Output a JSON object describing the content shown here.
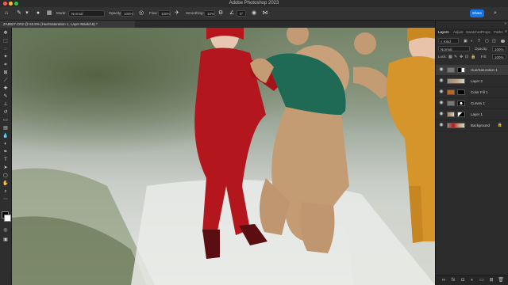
{
  "app": {
    "title": "Adobe Photoshop 2023"
  },
  "options_bar": {
    "mode_label": "Mode:",
    "mode_value": "Normal",
    "opacity_label": "Opacity:",
    "opacity_value": "100%",
    "flow_label": "Flow:",
    "flow_value": "100%",
    "smoothing_label": "Smoothing:",
    "smoothing_value": "10%",
    "angle_value": "0°",
    "share_label": "Share"
  },
  "document": {
    "tab_title": "ZA8927.CR2 @ 63.8% (Hue/Saturation 1, Layer Mask/16) *"
  },
  "panel": {
    "tabs": [
      "Layers",
      "Adjust",
      "Swatches",
      "Props",
      "Paths"
    ],
    "kind_label": "Kind",
    "blend_mode": "Normal",
    "opacity_label": "Opacity:",
    "opacity_value": "100%",
    "lock_label": "Lock:",
    "fill_label": "Fill:",
    "fill_value": "100%",
    "layers": [
      {
        "name": "Hue/Saturation 1",
        "selected": true
      },
      {
        "name": "Layer 2",
        "selected": false
      },
      {
        "name": "Color Fill 1",
        "selected": false
      },
      {
        "name": "Curves 1",
        "selected": false
      },
      {
        "name": "Layer 1",
        "selected": false
      },
      {
        "name": "Background",
        "selected": false,
        "locked": true
      }
    ]
  },
  "colors": {
    "accent": "#1473e6",
    "panel_bg": "#2c2c2c",
    "selection": "#3c3c3c",
    "fill_layer": "#b26a2e"
  }
}
